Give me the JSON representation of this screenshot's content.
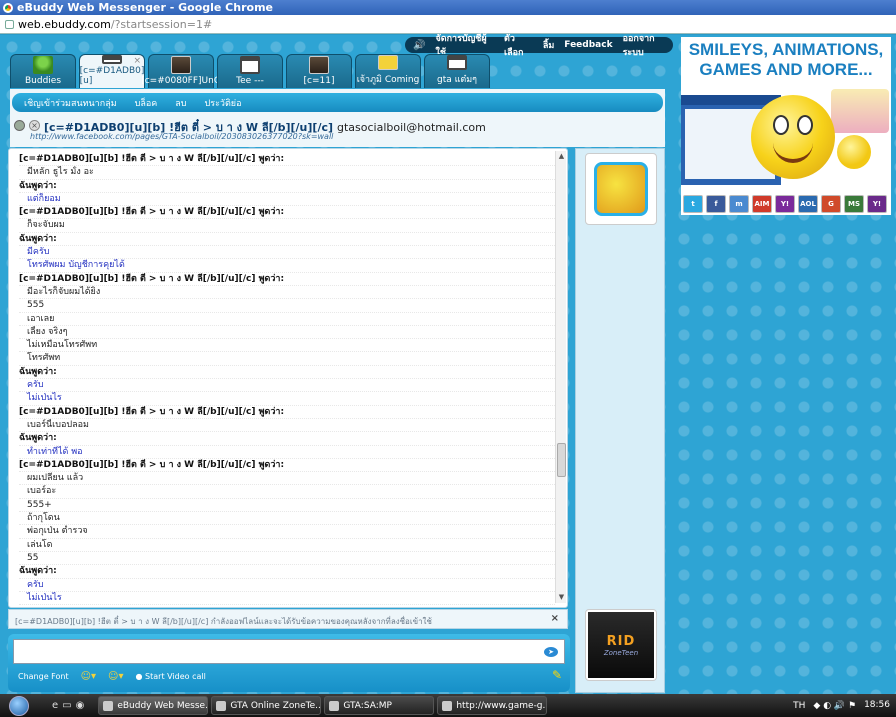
{
  "window": {
    "title": "eBuddy Web Messenger - Google Chrome",
    "url_host": "web.ebuddy.com",
    "url_path": "/?startsession=1#"
  },
  "topmenu": {
    "items": [
      "จัดการบัญชีผู้ใช้",
      "ตัวเลือก",
      "ลิ้ม",
      "Feedback",
      "ออกจากระบบ"
    ]
  },
  "tabs": [
    {
      "label": "Buddies",
      "icon": "buddy"
    },
    {
      "label": "[c=#D1ADB0][u]",
      "icon": "window",
      "active": true
    },
    {
      "label": "[c=#0080FF]UnG",
      "icon": "scene"
    },
    {
      "label": "Tee ---",
      "icon": "window"
    },
    {
      "label": "[c=11]",
      "icon": "scene"
    },
    {
      "label": "เจ้าภูมิ Coming",
      "icon": "yellow"
    },
    {
      "label": "gta แต๋มๆ",
      "icon": "window"
    }
  ],
  "chat_toolbar": {
    "items": [
      "เชิญเข้าร่วมสนทนากลุ่ม",
      "บล็อค",
      "ลบ",
      "ประวัติย่อ"
    ]
  },
  "contact": {
    "name": "[c=#D1ADB0][u][b] !ฮีต ตี๋ > บ า ง W ลี[/b][/u][/c]",
    "email": "gtasocialboil@hotmail.com",
    "url": "http://www.facebook.com/pages/GTA-Socialboil/203083026377020?sk=wall"
  },
  "messages": [
    {
      "type": "hdr",
      "text": "[c=#D1ADB0][u][b] !ฮีต ตี๋ > บ า ง W ลี[/b][/u][/c] พูดว่า:"
    },
    {
      "type": "in",
      "text": "มีหลัก ธูไร มั้ง อะ"
    },
    {
      "type": "hdr",
      "text": "ฉันพูดว่า:"
    },
    {
      "type": "out",
      "text": "แต่ก็ยอม"
    },
    {
      "type": "hdr",
      "text": "[c=#D1ADB0][u][b] !ฮีต ตี๋ > บ า ง W ลี[/b][/u][/c] พูดว่า:"
    },
    {
      "type": "in",
      "text": "ก็จะจับผม"
    },
    {
      "type": "hdr",
      "text": "ฉันพูดว่า:"
    },
    {
      "type": "out",
      "text": "มีครับ"
    },
    {
      "type": "out",
      "text": "โทรศัพผม บัญชีการคุยได้"
    },
    {
      "type": "hdr",
      "text": "[c=#D1ADB0][u][b] !ฮีต ตี๋ > บ า ง W ลี[/b][/u][/c] พูดว่า:"
    },
    {
      "type": "in",
      "text": "มีอะไรก็จับผมได้ยิ่ง"
    },
    {
      "type": "in",
      "text": "555"
    },
    {
      "type": "in",
      "text": "เอาเลย"
    },
    {
      "type": "in",
      "text": "เลี้ยง จริงๆ"
    },
    {
      "type": "in",
      "text": "ไม่เหมือนโทรศัพท"
    },
    {
      "type": "in",
      "text": "โทรศัพท"
    },
    {
      "type": "hdr",
      "text": "ฉันพูดว่า:"
    },
    {
      "type": "out",
      "text": "ครับ"
    },
    {
      "type": "out",
      "text": "ไม่เป่นไร"
    },
    {
      "type": "hdr",
      "text": "[c=#D1ADB0][u][b] !ฮีต ตี๋ > บ า ง W ลี[/b][/u][/c] พูดว่า:"
    },
    {
      "type": "in",
      "text": "เบอร์นี้เบอปลอม"
    },
    {
      "type": "hdr",
      "text": "ฉันพูดว่า:"
    },
    {
      "type": "out",
      "text": "ทำเท่าที่ได้ พอ"
    },
    {
      "type": "hdr",
      "text": "[c=#D1ADB0][u][b] !ฮีต ตี๋ > บ า ง W ลี[/b][/u][/c] พูดว่า:"
    },
    {
      "type": "in",
      "text": "ผมเปลี่ยน แล้ว"
    },
    {
      "type": "in",
      "text": "เบอร์อะ"
    },
    {
      "type": "in",
      "text": "555+"
    },
    {
      "type": "in",
      "text": "ถ้ากุโดน"
    },
    {
      "type": "in",
      "text": "พ่อกุเป่น ตำรวจ"
    },
    {
      "type": "in",
      "text": "เล่นโด"
    },
    {
      "type": "in",
      "text": "55"
    },
    {
      "type": "hdr",
      "text": "ฉันพูดว่า:"
    },
    {
      "type": "out",
      "text": "ครับ"
    },
    {
      "type": "out",
      "text": "ไม่เป่นไร"
    }
  ],
  "status": {
    "text": "[c=#D1ADB0][u][b] !ฮีต ตี๋ > บ า ง W ลี[/b][/u][/c] กำลังออฟไลน์และจะได้รับข้อความของคุณหลังจากที่ลงชื่อเข้าใช้",
    "close": "×"
  },
  "compose": {
    "placeholder": "",
    "change_font": "Change Font",
    "video_call": "Start Video call"
  },
  "side_ads": {
    "rid_text": "RID",
    "zone_text": "ZoneTeen"
  },
  "ad_banner": {
    "headline": "SMILEYS, ANIMATIONS, GAMES AND MORE...",
    "icons": [
      "t",
      "f",
      "m",
      "AIM",
      "Y!",
      "AOL",
      "G",
      "MS",
      "Y!"
    ]
  },
  "taskbar": {
    "buttons": [
      "eBuddy Web Messe...",
      "GTA Online ZoneTe...",
      "GTA:SA:MP",
      "http://www.game-g..."
    ],
    "lang": "TH",
    "time": "18:56"
  },
  "colors": {
    "accent": "#2ea4d4",
    "self_text": "#2330c0"
  }
}
